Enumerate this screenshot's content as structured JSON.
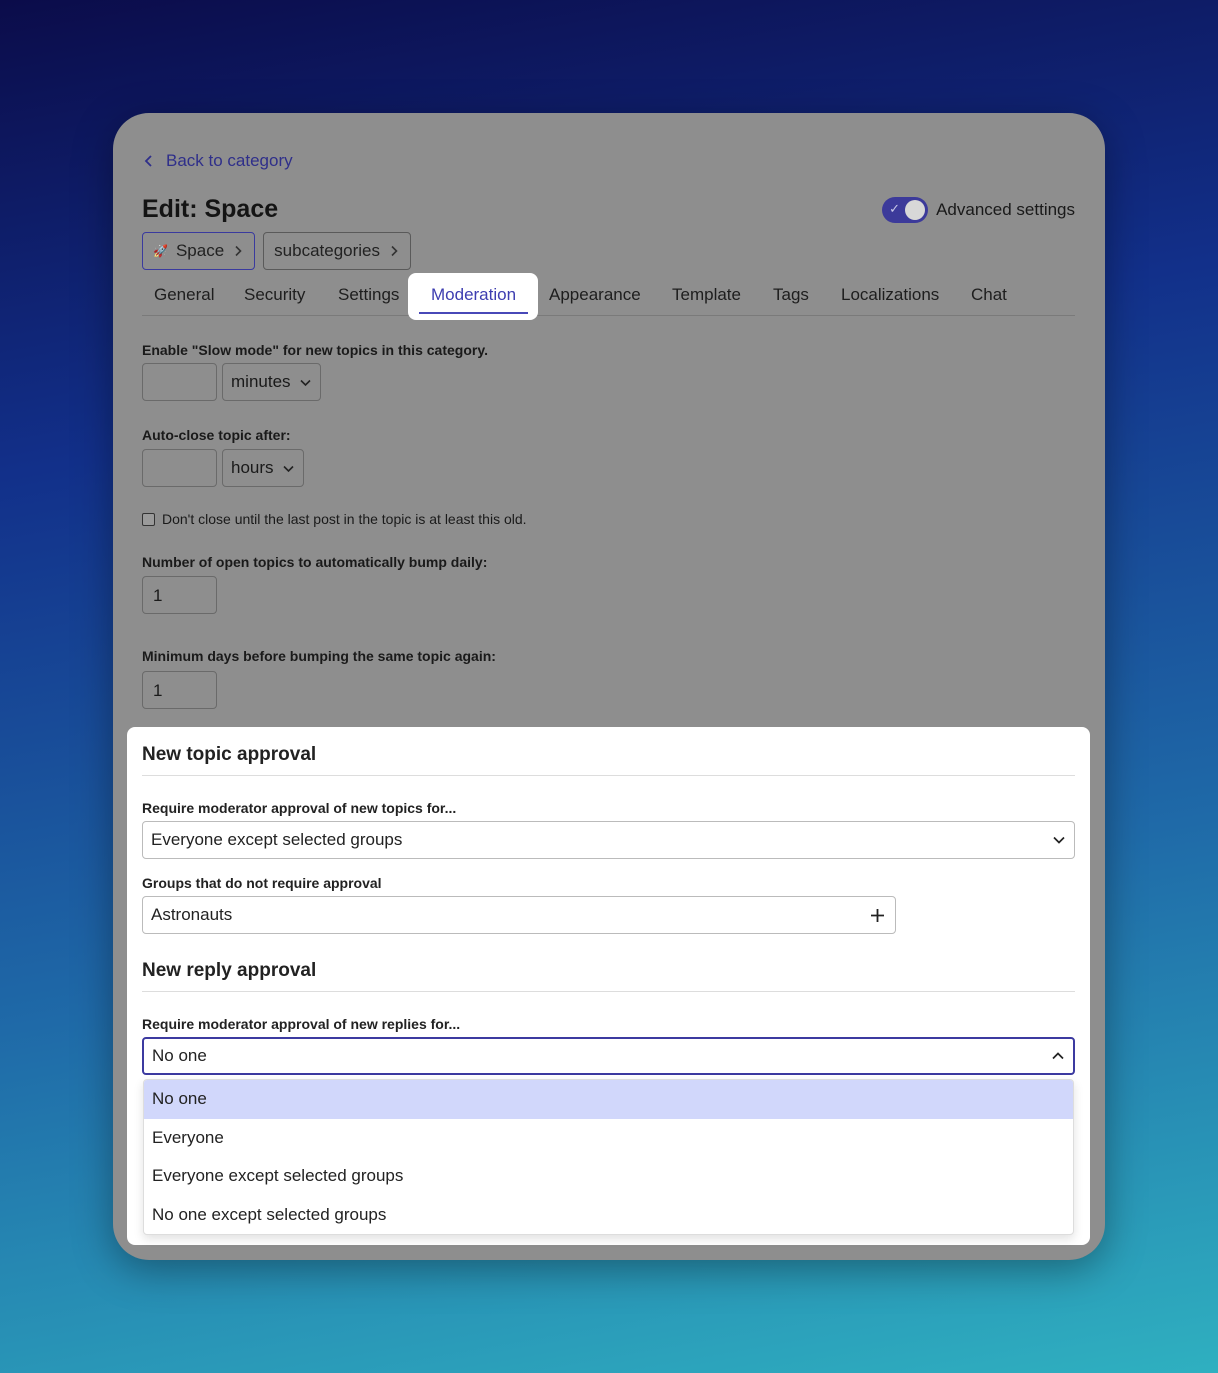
{
  "back": {
    "label": "Back to category"
  },
  "page": {
    "title": "Edit: Space"
  },
  "advanced": {
    "label": "Advanced settings",
    "enabled": true
  },
  "breadcrumbs": [
    {
      "label": "Space",
      "icon": "rocket-icon"
    },
    {
      "label": "subcategories"
    }
  ],
  "tabs": [
    "General",
    "Security",
    "Settings",
    "Moderation",
    "Appearance",
    "Template",
    "Tags",
    "Localizations",
    "Chat"
  ],
  "active_tab": "Moderation",
  "slow_mode": {
    "label": "Enable \"Slow mode\" for new topics in this category.",
    "value": "",
    "unit": "minutes"
  },
  "auto_close": {
    "label": "Auto-close topic after:",
    "value": "",
    "unit": "hours"
  },
  "dont_close": {
    "label": "Don't close until the last post in the topic is at least this old.",
    "checked": false
  },
  "bump_daily": {
    "label": "Number of open topics to automatically bump daily:",
    "value": "1"
  },
  "bump_min_days": {
    "label": "Minimum days before bumping the same topic again:",
    "value": "1"
  },
  "topic_approval": {
    "heading": "New topic approval",
    "require_label": "Require moderator approval of new topics for...",
    "require_value": "Everyone except selected groups",
    "groups_label": "Groups that do not require approval",
    "groups_value": "Astronauts"
  },
  "reply_approval": {
    "heading": "New reply approval",
    "require_label": "Require moderator approval of new replies for...",
    "require_value": "No one",
    "options": [
      "No one",
      "Everyone",
      "Everyone except selected groups",
      "No one except selected groups"
    ],
    "highlighted": "No one"
  }
}
